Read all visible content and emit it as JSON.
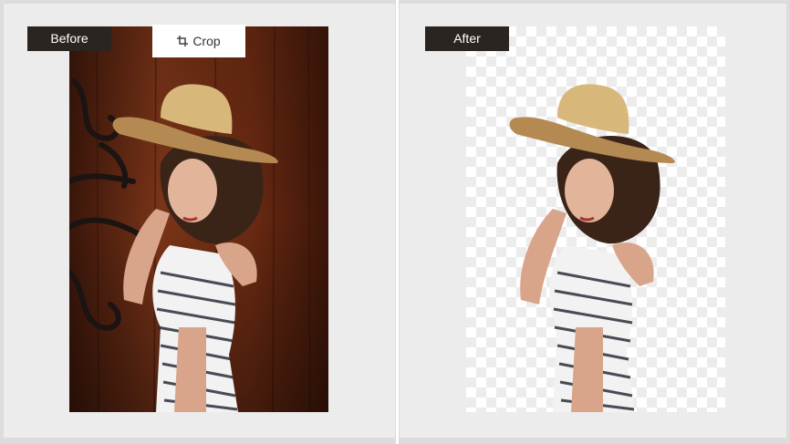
{
  "left_panel": {
    "tag_label": "Before",
    "crop_button_label": "Crop"
  },
  "right_panel": {
    "tag_label": "After"
  },
  "colors": {
    "tag_background": "#2b2522",
    "panel_background": "#ececec",
    "wood_background": "#6b2b14"
  },
  "icons": {
    "crop": "crop-icon"
  }
}
